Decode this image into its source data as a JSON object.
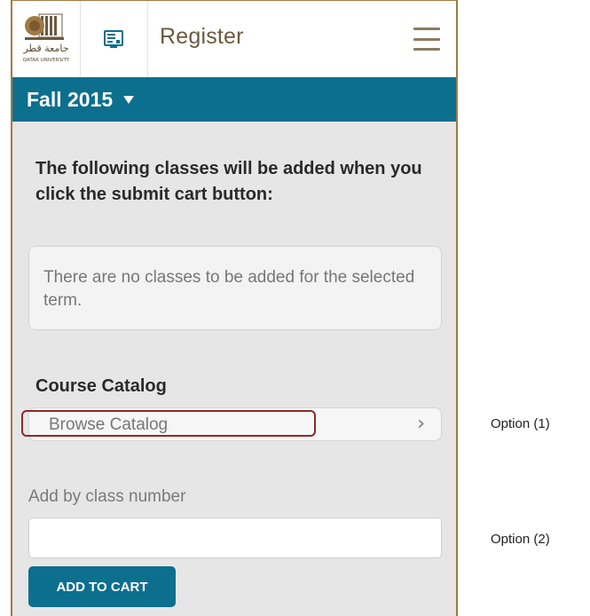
{
  "topbar": {
    "logo": {
      "arabic_text": "جامعة قطر",
      "english_text": "QATAR UNIVERSITY",
      "icon": "university-logo"
    },
    "classroom_icon": "classroom-board-icon",
    "title": "Register",
    "menu_icon": "hamburger-menu-icon"
  },
  "term": {
    "label": "Fall 2015",
    "icon": "caret-down-icon"
  },
  "cart": {
    "intro": "The following classes will be added when you click the submit cart button:",
    "empty_message": "There are no classes to be added for the selected term."
  },
  "catalog": {
    "heading": "Course Catalog",
    "browse_label": "Browse Catalog",
    "browse_chevron": "›"
  },
  "add_by_number": {
    "label": "Add by class number",
    "value": "",
    "placeholder": ""
  },
  "add_button_label": "ADD TO CART",
  "annotations": {
    "option1": "Option (1)",
    "option2": "Option (2)"
  },
  "colors": {
    "accent": "#0d6f8e",
    "frame": "#a07a45",
    "highlight": "#8c2a2a",
    "background": "#e6e6e6"
  }
}
